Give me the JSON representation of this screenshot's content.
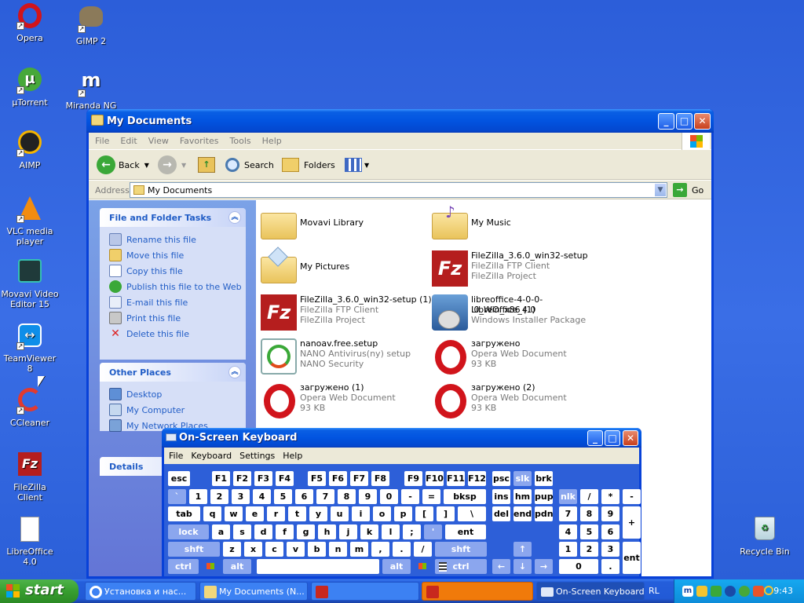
{
  "desktop": {
    "icons": [
      {
        "label": "Opera"
      },
      {
        "label": "GIMP 2"
      },
      {
        "label": "µTorrent"
      },
      {
        "label": "Miranda NG"
      },
      {
        "label": "AIMP"
      },
      {
        "label": "VLC media player"
      },
      {
        "label": "Movavi Video Editor 15"
      },
      {
        "label": "TeamViewer 8"
      },
      {
        "label": "CCleaner"
      },
      {
        "label": "FileZilla Client"
      },
      {
        "label": "LibreOffice 4.0"
      },
      {
        "label": "Recycle Bin"
      }
    ]
  },
  "explorer": {
    "title": "My Documents",
    "menu": [
      "File",
      "Edit",
      "View",
      "Favorites",
      "Tools",
      "Help"
    ],
    "toolbar": {
      "back": "Back",
      "search": "Search",
      "folders": "Folders"
    },
    "address": {
      "label": "Address",
      "value": "My Documents",
      "go": "Go"
    },
    "file_tasks": {
      "title": "File and Folder Tasks",
      "items": [
        "Rename this file",
        "Move this file",
        "Copy this file",
        "Publish this file to the Web",
        "E-mail this file",
        "Print this file",
        "Delete this file"
      ]
    },
    "other_places": {
      "title": "Other Places",
      "items": [
        "Desktop",
        "My Computer",
        "My Network Places"
      ]
    },
    "details": {
      "title": "Details"
    },
    "files": [
      {
        "name": "Movavi Library",
        "line2": "",
        "line3": "",
        "icon": "folder-icon"
      },
      {
        "name": "My Music",
        "line2": "",
        "line3": "",
        "icon": "music-folder-icon"
      },
      {
        "name": "My Pictures",
        "line2": "",
        "line3": "",
        "icon": "pictures-folder-icon"
      },
      {
        "name": "FileZilla_3.6.0_win32-setup",
        "line2": "FileZilla FTP Client",
        "line3": "FileZilla Project",
        "icon": "filezilla-icon"
      },
      {
        "name": "FileZilla_3.6.0_win32-setup (1)",
        "line2": "FileZilla FTP Client",
        "line3": "FileZilla Project",
        "icon": "filezilla-icon"
      },
      {
        "name": "libreoffice-4-0-0-LibreOffice_4.0",
        "line2": ".0_Win_x86 (1)",
        "line3": "Windows Installer Package",
        "icon": "installer-icon"
      },
      {
        "name": "nanoav.free.setup",
        "line2": "NANO Antivirus(ny) setup",
        "line3": "NANO Security",
        "icon": "nano-icon"
      },
      {
        "name": "загружено",
        "line2": "Opera Web Document",
        "line3": "93 KB",
        "icon": "opera-icon"
      },
      {
        "name": "загружено (1)",
        "line2": "Opera Web Document",
        "line3": "93 KB",
        "icon": "opera-icon"
      },
      {
        "name": "загружено (2)",
        "line2": "Opera Web Document",
        "line3": "93 KB",
        "icon": "opera-icon"
      }
    ]
  },
  "osk": {
    "title": "On-Screen Keyboard",
    "menu": [
      "File",
      "Keyboard",
      "Settings",
      "Help"
    ],
    "keys": [
      "esc",
      "F1",
      "F2",
      "F3",
      "F4",
      "F5",
      "F6",
      "F7",
      "F8",
      "F9",
      "F10",
      "F11",
      "F12",
      "psc",
      "slk",
      "brk",
      "`",
      "1",
      "2",
      "3",
      "4",
      "5",
      "6",
      "7",
      "8",
      "9",
      "0",
      "-",
      "=",
      "bksp",
      "ins",
      "hm",
      "pup",
      "nlk",
      "/",
      "*",
      "-",
      "tab",
      "q",
      "w",
      "e",
      "r",
      "t",
      "y",
      "u",
      "i",
      "o",
      "p",
      "[",
      "]",
      "\\",
      "del",
      "end",
      "pdn",
      "7",
      "8",
      "9",
      "+",
      "lock",
      "a",
      "s",
      "d",
      "f",
      "g",
      "h",
      "j",
      "k",
      "l",
      ";",
      "'",
      "ent",
      "4",
      "5",
      "6",
      "shft",
      "z",
      "x",
      "c",
      "v",
      "b",
      "n",
      "m",
      ",",
      ".",
      "/",
      "shft",
      "↑",
      "1",
      "2",
      "3",
      "ent",
      "ctrl",
      "alt",
      "alt",
      "ctrl",
      "←",
      "↓",
      "→",
      "0",
      "."
    ]
  },
  "taskbar": {
    "start": "start",
    "buttons": [
      "Установка и нас...",
      "My Documents (N...",
      "",
      "",
      "On-Screen Keyboard"
    ],
    "lang": "RL",
    "clock": "9:43"
  }
}
